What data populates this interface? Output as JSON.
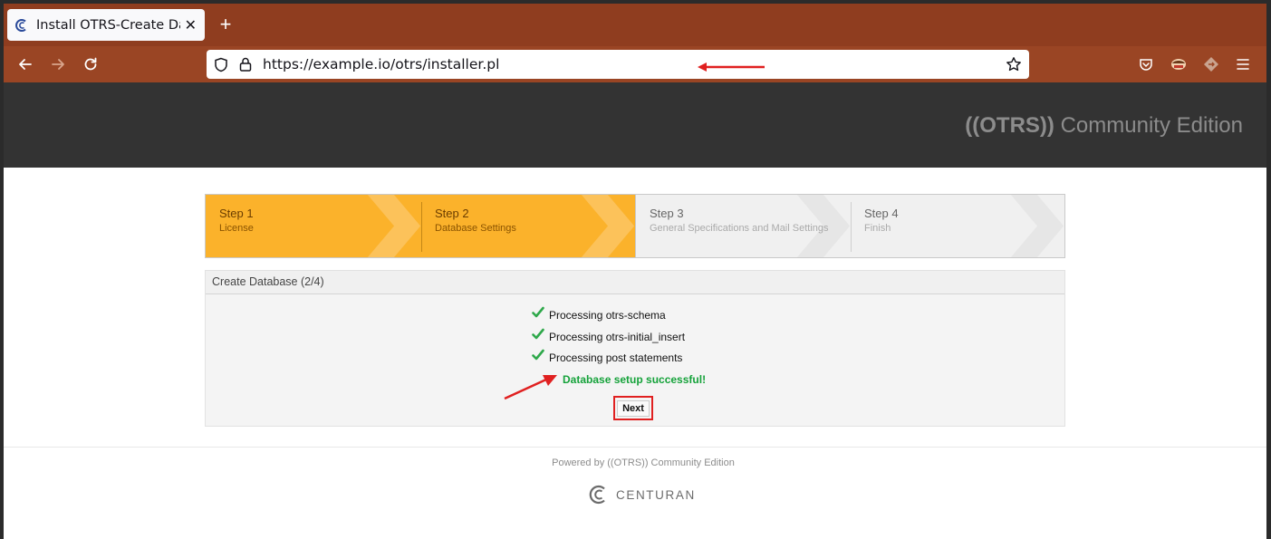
{
  "browser": {
    "tab_title": "Install OTRS-Create Datab",
    "tab_close": "✕",
    "new_tab": "+",
    "url": "https://example.io/otrs/installer.pl",
    "colors": {
      "tabbar": "#8f3d1f",
      "navbar": "#9a4524"
    }
  },
  "header": {
    "logo_mark": "((OTRS))",
    "logo_text": "Community Edition"
  },
  "steps": [
    {
      "title": "Step 1",
      "subtitle": "License",
      "status": "done"
    },
    {
      "title": "Step 2",
      "subtitle": "Database Settings",
      "status": "done"
    },
    {
      "title": "Step 3",
      "subtitle": "General Specifications and Mail Settings",
      "status": "pending"
    },
    {
      "title": "Step 4",
      "subtitle": "Finish",
      "status": "pending"
    }
  ],
  "panel": {
    "title": "Create Database (2/4)",
    "processes": [
      "Processing otrs-schema",
      "Processing otrs-initial_insert",
      "Processing post statements"
    ],
    "success_message": "Database setup successful!",
    "next_label": "Next"
  },
  "footer": {
    "powered_by": "Powered by ((OTRS)) Community Edition",
    "brand": "CENTURAN"
  },
  "colors": {
    "step_done": "#fbb22b",
    "step_pending": "#f0f0f0",
    "success": "#15a23a",
    "annotation_red": "#e02020"
  }
}
